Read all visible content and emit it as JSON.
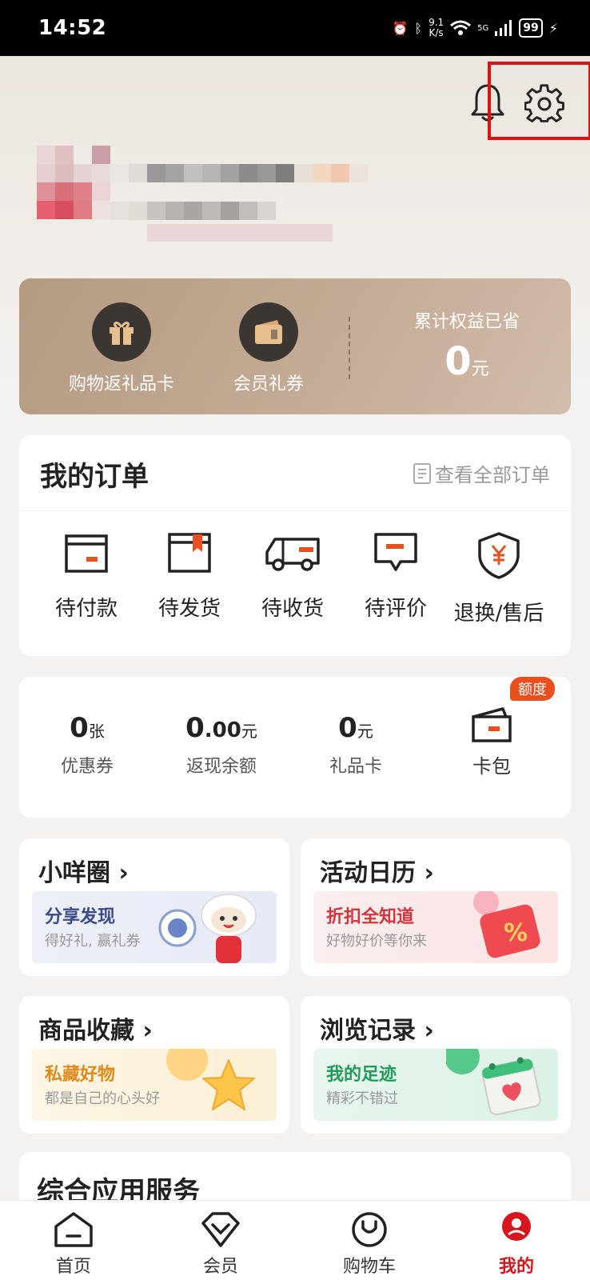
{
  "status_bar": {
    "time": "14:52",
    "net_speed": "9.1",
    "net_unit": "K/s",
    "signal_label": "5G",
    "battery": "99"
  },
  "member_card": {
    "items": [
      {
        "label": "购物返礼品卡"
      },
      {
        "label": "会员礼券"
      }
    ],
    "savings_label": "累计权益已省",
    "savings_value": "0",
    "savings_unit": "元"
  },
  "orders": {
    "title": "我的订单",
    "view_all": "查看全部订单",
    "items": [
      {
        "label": "待付款",
        "icon": "wallet-icon"
      },
      {
        "label": "待发货",
        "icon": "package-icon"
      },
      {
        "label": "待收货",
        "icon": "truck-icon"
      },
      {
        "label": "待评价",
        "icon": "comment-icon"
      },
      {
        "label": "退换/售后",
        "icon": "shield-yen-icon"
      }
    ]
  },
  "assets": {
    "coupons": {
      "value": "0",
      "unit": "张",
      "label": "优惠券"
    },
    "cashback": {
      "value": "0",
      "decimal": ".00",
      "unit": "元",
      "label": "返现余额"
    },
    "gift_card": {
      "value": "0",
      "unit": "元",
      "label": "礼品卡"
    },
    "wallet": {
      "label": "卡包",
      "badge": "额度"
    }
  },
  "tiles": {
    "circle": {
      "title": "小咩圈",
      "chevron": "›",
      "banner_title": "分享发现",
      "banner_sub": "得好礼, 赢礼券"
    },
    "calendar": {
      "title": "活动日历",
      "chevron": "›",
      "banner_title": "折扣全知道",
      "banner_sub": "好物好价等你来"
    },
    "favorites": {
      "title": "商品收藏",
      "chevron": "›",
      "banner_title": "私藏好物",
      "banner_sub": "都是自己的心头好"
    },
    "history": {
      "title": "浏览记录",
      "chevron": "›",
      "banner_title": "我的足迹",
      "banner_sub": "精彩不错过"
    }
  },
  "services": {
    "title": "综合应用服务"
  },
  "tabbar": {
    "items": [
      {
        "label": "首页",
        "icon": "home-icon"
      },
      {
        "label": "会员",
        "icon": "member-icon"
      },
      {
        "label": "购物车",
        "icon": "cart-icon"
      },
      {
        "label": "我的",
        "icon": "profile-icon"
      }
    ],
    "active_index": 3
  },
  "colors": {
    "accent": "#d8141c",
    "brand_orange": "#e8501f",
    "card_gold": "#b59a82"
  }
}
